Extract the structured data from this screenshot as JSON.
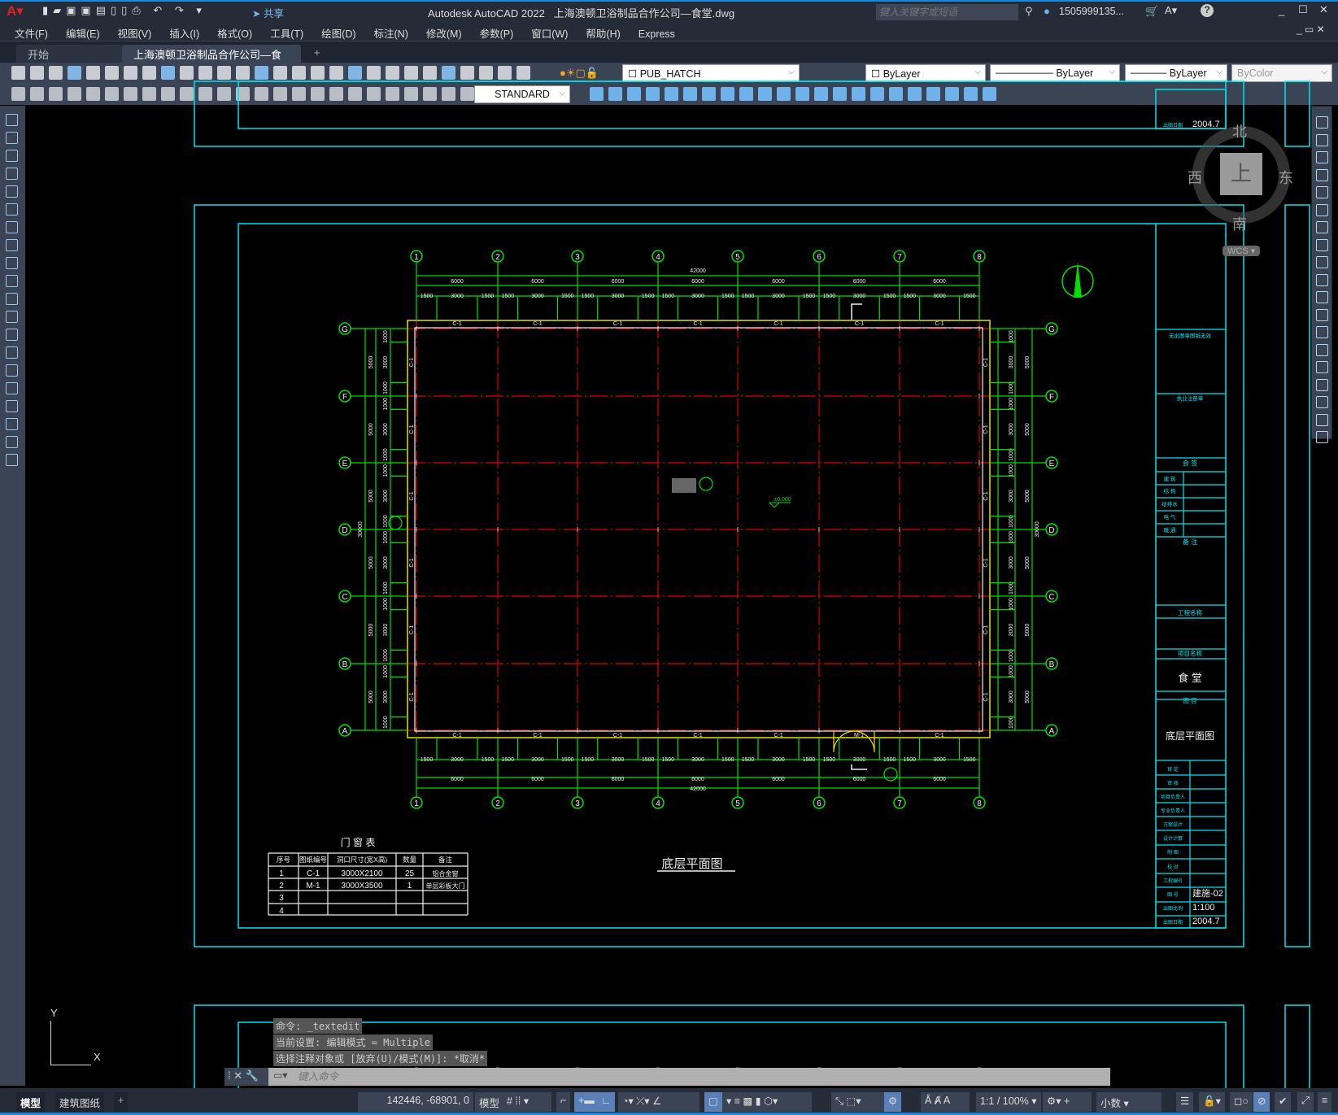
{
  "app": {
    "title": "Autodesk AutoCAD 2022",
    "file": "上海澳顿卫浴制品合作公司—食堂.dwg",
    "share": "共享",
    "search_placeholder": "键入关键字或短语",
    "user": "1505999135...",
    "accent": "#1e88d8"
  },
  "menu": [
    "文件(F)",
    "编辑(E)",
    "视图(V)",
    "插入(I)",
    "格式(O)",
    "工具(T)",
    "绘图(D)",
    "标注(N)",
    "修改(M)",
    "参数(P)",
    "窗口(W)",
    "帮助(H)",
    "Express"
  ],
  "doc_tabs": [
    {
      "label": "开始",
      "active": false
    },
    {
      "label": "上海澳顿卫浴制品合作公司—食堂*",
      "active": true
    }
  ],
  "toolbar": {
    "layer": "PUB_HATCH",
    "color": "ByLayer",
    "linetype": "ByLayer",
    "lineweight": "ByLayer",
    "plotstyle": "ByColor",
    "dimstyle": "STANDARD"
  },
  "viewcube": {
    "north": "北",
    "south": "南",
    "east": "东",
    "west": "西",
    "top": "上",
    "wcs": "WCS"
  },
  "drawing": {
    "grid_cols": [
      "1",
      "2",
      "3",
      "4",
      "5",
      "6",
      "7",
      "8"
    ],
    "grid_rows": [
      "G",
      "F",
      "E",
      "D",
      "C",
      "B",
      "A"
    ],
    "total_x": "42000",
    "bay_x": "6000",
    "sub_x": [
      "1500",
      "3000",
      "1500"
    ],
    "total_y": "30000",
    "bay_y": "5000",
    "sub_y": [
      "1000",
      "3000",
      "1000"
    ],
    "window_tag": "C-1",
    "door_tag": "M-1",
    "elevation": "±0.000",
    "plan_title": "底层平面图",
    "schedule": {
      "title": "门 窗 表",
      "headers": [
        "序号",
        "图纸编号",
        "洞口尺寸(宽X高)",
        "数量",
        "备注"
      ],
      "rows": [
        [
          "1",
          "C-1",
          "3000X2100",
          "25",
          "铝合金窗"
        ],
        [
          "2",
          "M-1",
          "3000X3500",
          "1",
          "单层彩板大门"
        ],
        [
          "3",
          "",
          "",
          "",
          ""
        ],
        [
          "4",
          "",
          "",
          "",
          ""
        ]
      ]
    },
    "title_block": {
      "stamp1": "无出图章图纸无效",
      "stamp2": "执业注册章",
      "countersign": "会 签",
      "disciplines": [
        "建 筑",
        "结 构",
        "给排水",
        "电 气",
        "暖 通"
      ],
      "remarks": "备 注",
      "project_label": "工程名称",
      "item_label": "项目名称",
      "item": "食 堂",
      "drawing_label": "图 目",
      "drawing_name": "底层平面图",
      "roles": [
        "审 定",
        "审 核",
        "项目负责人",
        "专业负责人",
        "方案设计",
        "设计计算",
        "制 图",
        "校 对",
        "工程编号"
      ],
      "fields": [
        [
          "图 号",
          "建施-02"
        ],
        [
          "出图比例",
          "1:100"
        ],
        [
          "出图日期",
          "2004.7"
        ]
      ]
    }
  },
  "command": {
    "history": [
      "命令: _textedit",
      "当前设置: 编辑模式 = Multiple",
      "选择注释对象或 [放弃(U)/模式(M)]: *取消*"
    ],
    "placeholder": "键入命令"
  },
  "layout_tabs": [
    "模型",
    "建筑图纸"
  ],
  "status": {
    "coords": "142446, -68901, 0",
    "space": "模型",
    "scale": "1:1 / 100%",
    "units": "小数"
  }
}
